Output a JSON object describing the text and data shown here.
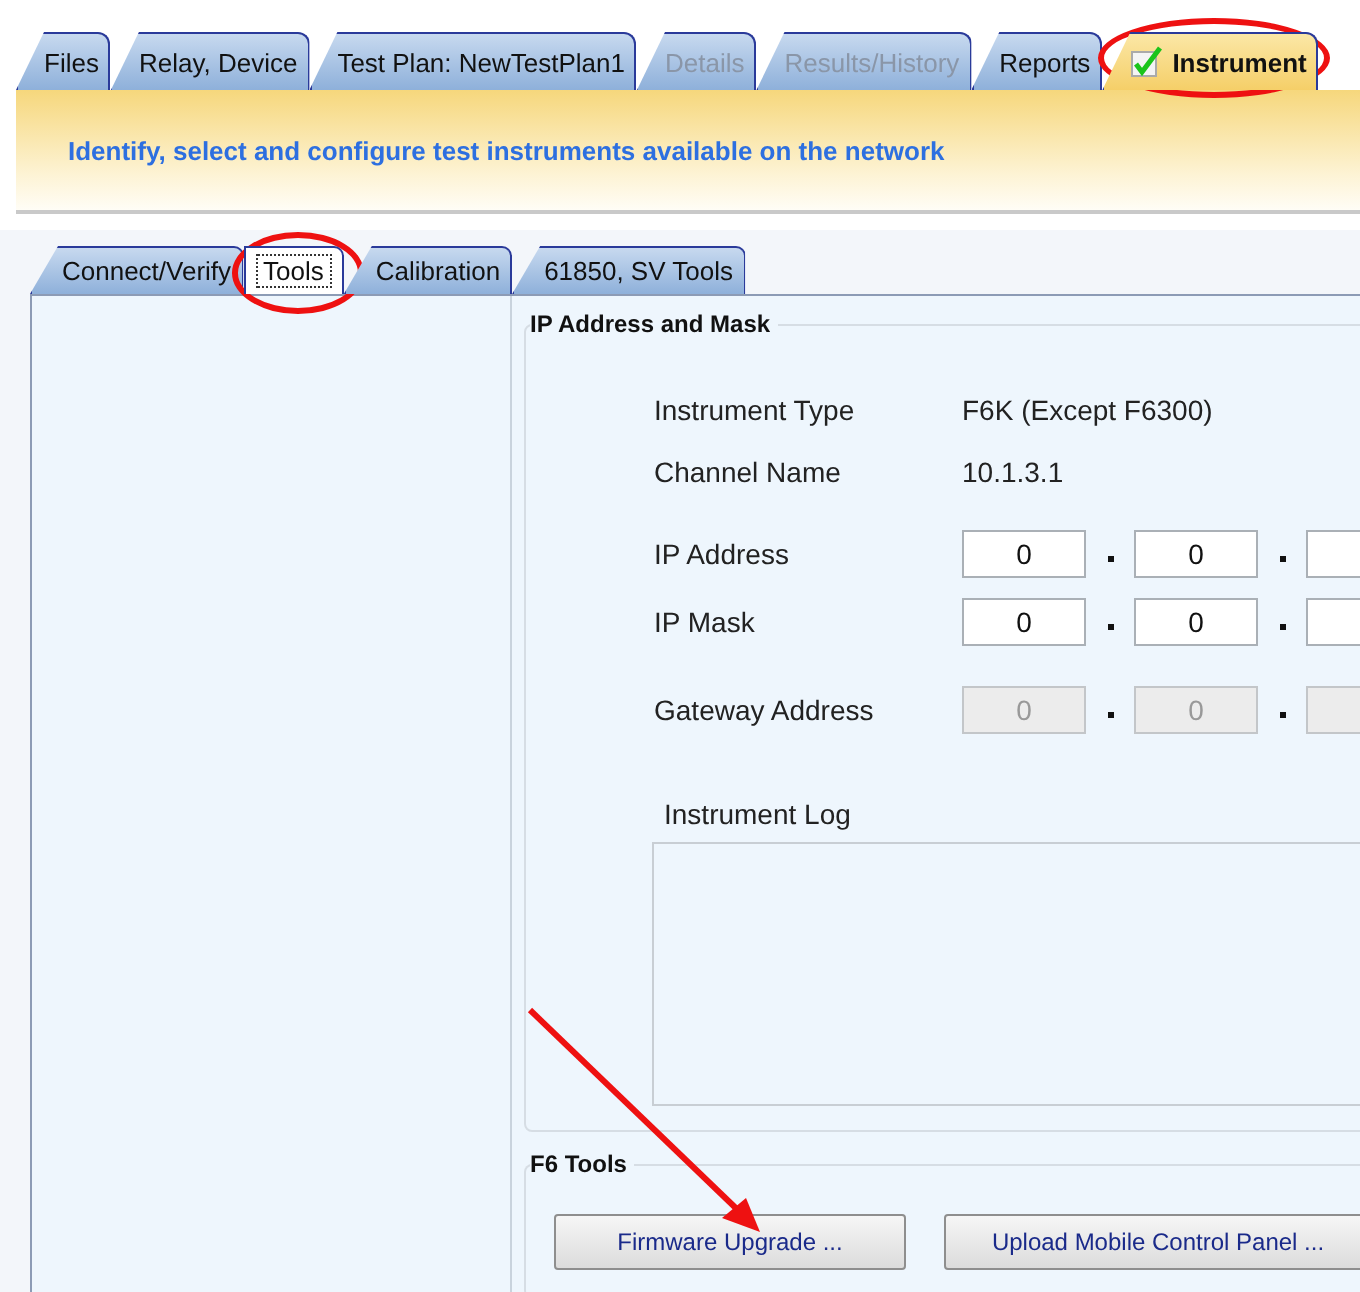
{
  "tabs": [
    {
      "label": "Files",
      "selected": false,
      "disabled": false,
      "checked": false,
      "circled": false
    },
    {
      "label": "Relay, Device",
      "selected": false,
      "disabled": false,
      "checked": false,
      "circled": false
    },
    {
      "label": "Test Plan: NewTestPlan1",
      "selected": false,
      "disabled": false,
      "checked": false,
      "circled": false
    },
    {
      "label": "Details",
      "selected": false,
      "disabled": true,
      "checked": false,
      "circled": false
    },
    {
      "label": "Results/History",
      "selected": false,
      "disabled": true,
      "checked": false,
      "circled": false
    },
    {
      "label": "Reports",
      "selected": false,
      "disabled": false,
      "checked": false,
      "circled": false
    },
    {
      "label": "Instrument",
      "selected": true,
      "disabled": false,
      "checked": true,
      "circled": true
    }
  ],
  "banner": {
    "text": "Identify, select and configure test instruments available on the network"
  },
  "subtabs": [
    {
      "label": "Connect/Verify",
      "selected": false,
      "circled": false
    },
    {
      "label": "Tools",
      "selected": true,
      "circled": true
    },
    {
      "label": "Calibration",
      "selected": false,
      "circled": false
    },
    {
      "label": "61850, SV Tools",
      "selected": false,
      "circled": false
    }
  ],
  "ip_group": {
    "title": "IP Address and Mask",
    "info": [
      {
        "label": "Instrument Type",
        "value": "F6K (Except F6300)"
      },
      {
        "label": "Channel Name",
        "value": "10.1.3.1"
      }
    ],
    "addresses": [
      {
        "label": "IP Address",
        "disabled": false,
        "octets": [
          "0",
          "0"
        ]
      },
      {
        "label": "IP Mask",
        "disabled": false,
        "octets": [
          "0",
          "0"
        ]
      },
      {
        "label": "Gateway Address",
        "disabled": true,
        "octets": [
          "0",
          "0"
        ]
      }
    ],
    "log": {
      "label": "Instrument Log"
    }
  },
  "f6_tools": {
    "title": "F6 Tools",
    "buttons": [
      {
        "label": "Firmware Upgrade ...",
        "pointed": true
      },
      {
        "label": "Upload Mobile Control Panel ...",
        "pointed": false
      }
    ]
  }
}
